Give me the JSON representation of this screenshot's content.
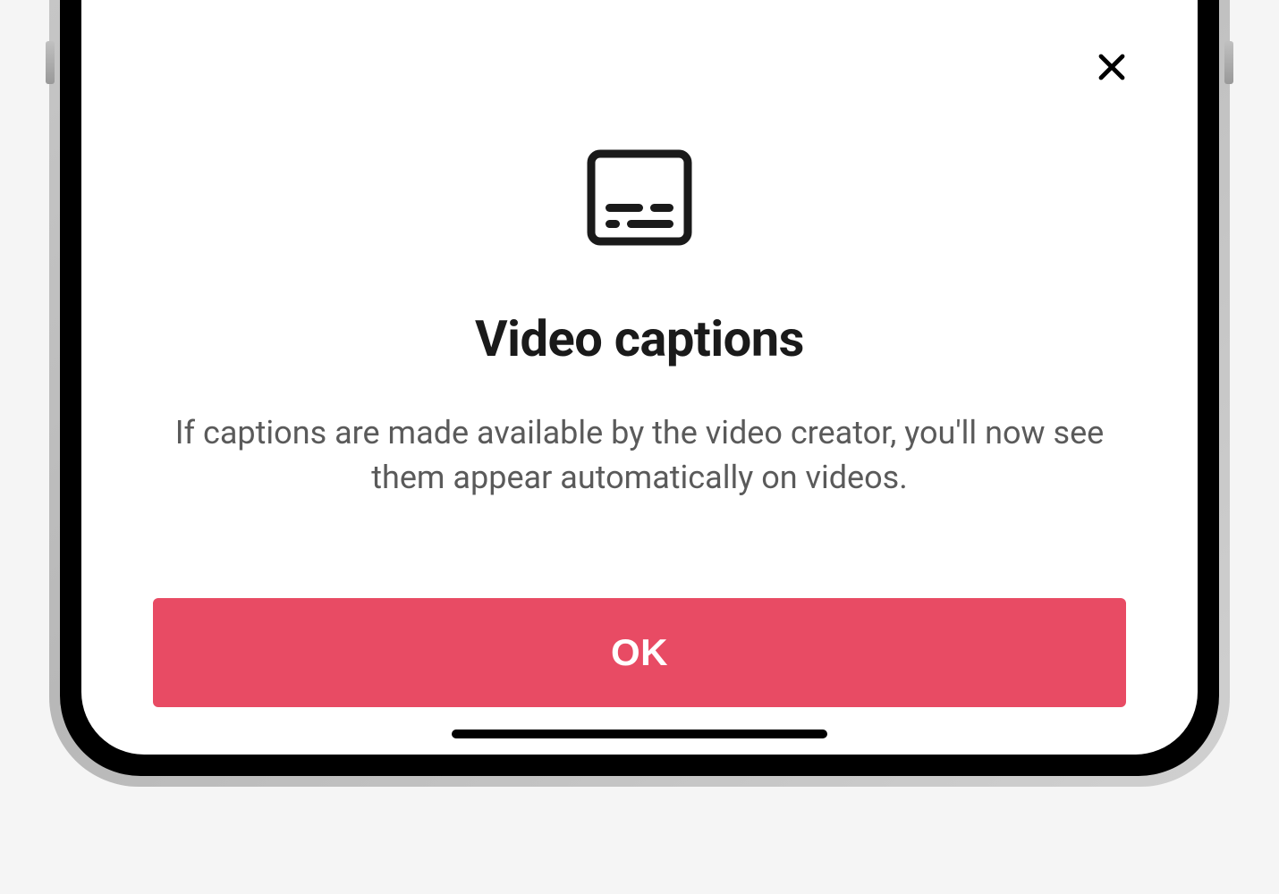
{
  "modal": {
    "title": "Video captions",
    "body": "If captions are made available by the video creator, you'll now see them appear automatically on videos.",
    "ok_label": "OK"
  },
  "icons": {
    "close": "close-icon",
    "captions": "captions-icon"
  },
  "colors": {
    "primary_button": "#e84b64",
    "title_text": "#1a1a1a",
    "body_text": "#5a5a5a"
  }
}
